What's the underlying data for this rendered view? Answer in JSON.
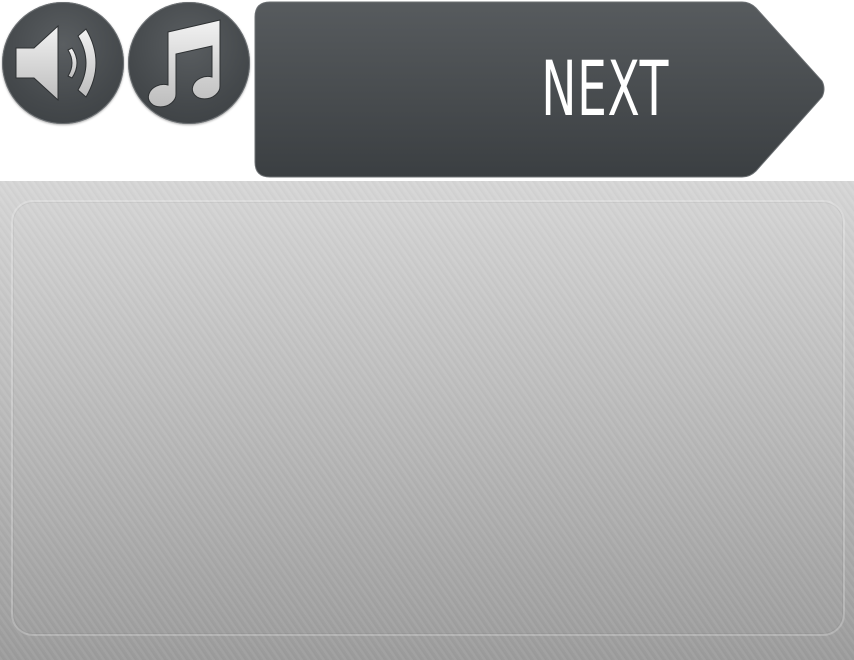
{
  "toolbar": {
    "sound_icon": "speaker-volume-icon",
    "music_icon": "music-note-icon",
    "next_label": "NEXT"
  },
  "colors": {
    "button_dark": "#45494c",
    "button_rim": "#6c7073",
    "icon_light": "#e6e6e6",
    "label_text": "#ffffff",
    "panel_top": "#d6d6d6",
    "panel_bottom": "#9c9c9c"
  },
  "panel": {
    "content": ""
  }
}
